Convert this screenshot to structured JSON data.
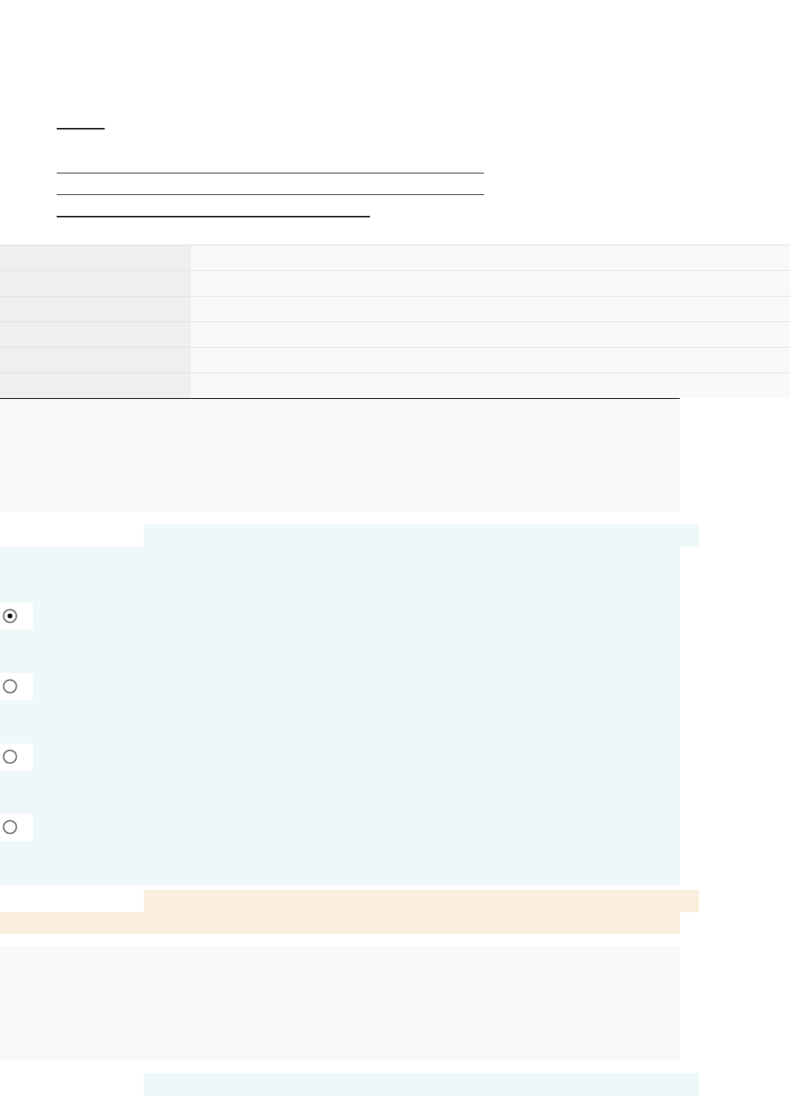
{
  "question": {
    "options": [
      {
        "selected": true
      },
      {
        "selected": false
      },
      {
        "selected": false
      },
      {
        "selected": false
      }
    ]
  }
}
